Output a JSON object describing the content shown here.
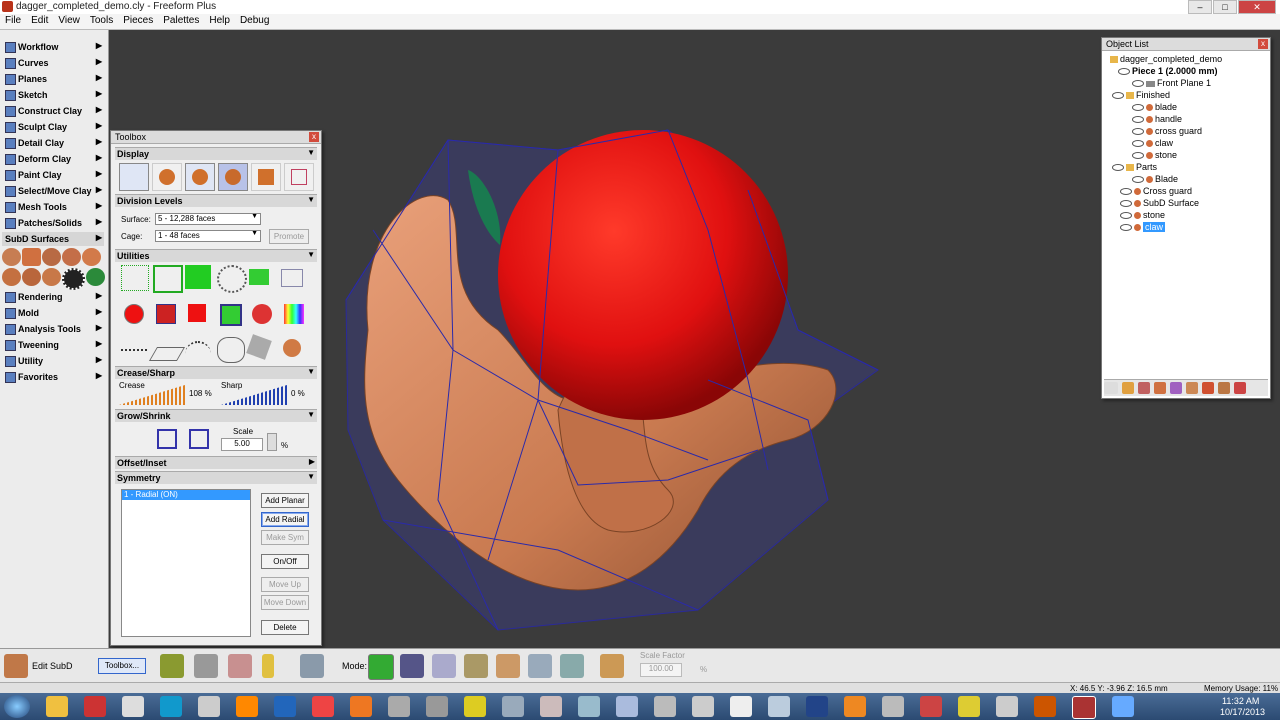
{
  "window": {
    "title": "dagger_completed_demo.cly - Freeform Plus",
    "min": "–",
    "max": "□",
    "close": "✕"
  },
  "menu": [
    "File",
    "Edit",
    "View",
    "Tools",
    "Pieces",
    "Palettes",
    "Help",
    "Debug"
  ],
  "left_palette": {
    "items": [
      {
        "label": "Workflow"
      },
      {
        "label": "Curves"
      },
      {
        "label": "Planes"
      },
      {
        "label": "Sketch"
      },
      {
        "label": "Construct Clay"
      },
      {
        "label": "Sculpt Clay"
      },
      {
        "label": "Detail Clay"
      },
      {
        "label": "Deform Clay"
      },
      {
        "label": "Paint Clay"
      },
      {
        "label": "Select/Move Clay"
      },
      {
        "label": "Mesh Tools"
      },
      {
        "label": "Patches/Solids"
      },
      {
        "label": "SubD Surfaces"
      },
      {
        "label": "Rendering"
      },
      {
        "label": "Mold"
      },
      {
        "label": "Analysis Tools"
      },
      {
        "label": "Tweening"
      },
      {
        "label": "Utility"
      },
      {
        "label": "Favorites"
      }
    ],
    "arrow": "▶"
  },
  "toolbox": {
    "title": "Toolbox",
    "close": "x",
    "sections": {
      "display": "Display",
      "division": "Division Levels",
      "utilities": "Utilities",
      "crease": "Crease/Sharp",
      "grow": "Grow/Shrink",
      "offset": "Offset/Inset",
      "symmetry": "Symmetry"
    },
    "surface_label": "Surface:",
    "surface_value": "5 - 12,288 faces",
    "cage_label": "Cage:",
    "cage_value": "1 - 48 faces",
    "promote": "Promote",
    "crease_label": "Crease",
    "crease_value": "108 %",
    "sharp_label": "Sharp",
    "sharp_value": "0 %",
    "scale_label": "Scale",
    "scale_value": "5.00",
    "scale_unit": "%",
    "sym_item": "1 - Radial (ON)",
    "buttons": {
      "add_planar": "Add Planar",
      "add_radial": "Add Radial",
      "make_sym": "Make Sym",
      "on_off": "On/Off",
      "move_up": "Move Up",
      "move_down": "Move Down",
      "delete": "Delete"
    }
  },
  "object_list": {
    "title": "Object List",
    "close": "x",
    "root": "dagger_completed_demo",
    "piece": "Piece 1 (2.0000 mm)",
    "front_plane": "Front Plane 1",
    "finished": "Finished",
    "finished_children": [
      "blade",
      "handle",
      "cross guard",
      "claw",
      "stone"
    ],
    "parts": "Parts",
    "parts_children": [
      "Blade"
    ],
    "others": [
      "Cross guard",
      "SubD Surface",
      "stone"
    ],
    "selected": "claw"
  },
  "bottom_bar": {
    "edit_subd": "Edit SubD",
    "toolbox_btn": "Toolbox...",
    "mode_label": "Mode:",
    "scale_factor_label": "Scale Factor",
    "scale_factor_value": "100.00",
    "scale_factor_unit": "%"
  },
  "status": {
    "coords": "X: 46.5    Y: -3.96    Z: 16.5    mm",
    "memory": "Memory Usage: 11%"
  },
  "taskbar": {
    "time": "11:32 AM",
    "date": "10/17/2013"
  },
  "colors": {
    "sphere": "#e01010",
    "clay": "#d98a5c",
    "cage": "#2a2a9a",
    "selected": "#3399ff"
  }
}
